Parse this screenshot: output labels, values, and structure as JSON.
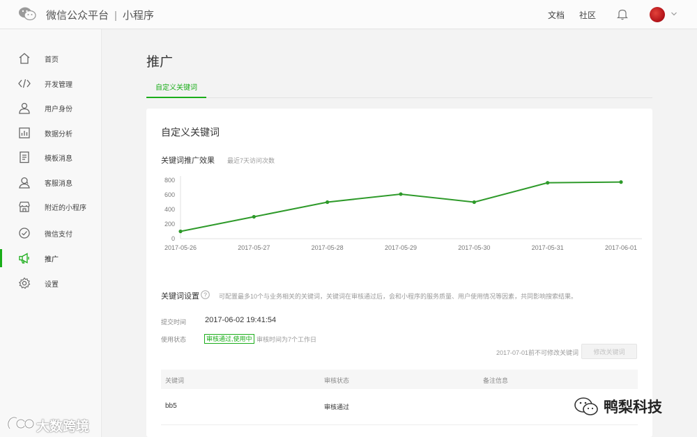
{
  "header": {
    "brand": "微信公众平台",
    "separator": "|",
    "product": "小程序",
    "links": [
      "文档",
      "社区"
    ]
  },
  "sidebar": {
    "items": [
      {
        "label": "首页",
        "icon": "home-icon"
      },
      {
        "label": "开发管理",
        "icon": "code-icon"
      },
      {
        "label": "用户身份",
        "icon": "user-icon"
      },
      {
        "label": "数据分析",
        "icon": "bar-chart-icon"
      },
      {
        "label": "模板消息",
        "icon": "document-icon"
      },
      {
        "label": "客服消息",
        "icon": "headset-user-icon"
      },
      {
        "label": "附近的小程序",
        "icon": "store-icon"
      },
      {
        "label": "微信支付",
        "icon": "pay-icon"
      },
      {
        "label": "推广",
        "icon": "megaphone-icon",
        "active": true
      },
      {
        "label": "设置",
        "icon": "gear-icon"
      }
    ]
  },
  "main": {
    "title": "推广",
    "tab": "自定义关键词",
    "card_title": "自定义关键词",
    "chart_title": "关键词推广效果",
    "chart_subtitle": "最近7天访问次数",
    "keyword_settings": {
      "title": "关键词设置",
      "description": "可配置最多10个与业务相关的关键词，关键词在审核通过后，会和小程序的服务质量、用户使用情况等因素，共同影响搜索结果。",
      "submit_time_label": "提交时间",
      "submit_time": "2017-06-02 19:41:54",
      "status_label": "使用状态",
      "status": "审核通过,使用中",
      "status_note": "审核时间为7个工作日",
      "modify_note": "2017-07-01前不可修改关键词",
      "modify_button": "修改关键词"
    },
    "table": {
      "headers": [
        "关键词",
        "审核状态",
        "备注信息"
      ],
      "rows": [
        {
          "keyword": "bb5",
          "status": "审核通过",
          "note": ""
        }
      ]
    }
  },
  "chart_data": {
    "type": "line",
    "categories": [
      "2017-05-26",
      "2017-05-27",
      "2017-05-28",
      "2017-05-29",
      "2017-05-30",
      "2017-05-31",
      "2017-06-01"
    ],
    "values": [
      100,
      300,
      500,
      610,
      500,
      765,
      775
    ],
    "yticks": [
      0,
      200,
      400,
      600,
      800
    ],
    "ylim": [
      0,
      800
    ],
    "color": "#2e9a2a",
    "grid": false
  },
  "watermarks": {
    "left": "大数跨境",
    "right": "鸭梨科技"
  },
  "colors": {
    "accent": "#1aad19",
    "line": "#2e9a2a"
  }
}
